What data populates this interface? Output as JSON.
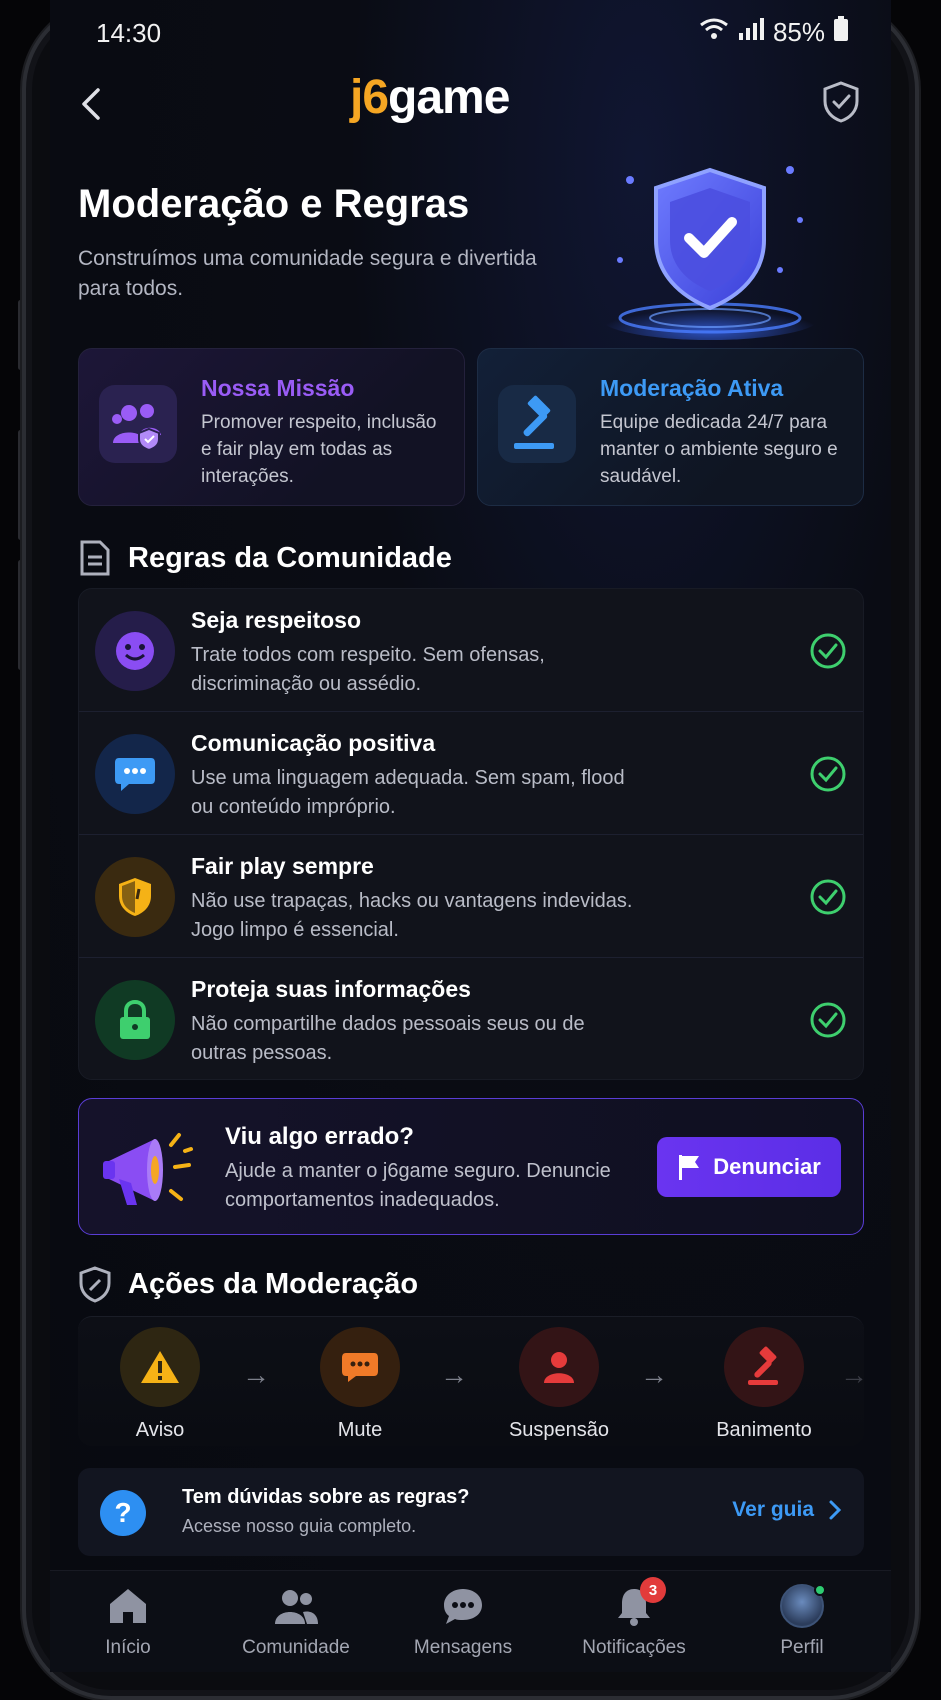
{
  "status_bar": {
    "time": "14:30",
    "battery": "85%"
  },
  "header": {
    "logo_part1": "j6",
    "logo_part2": "game"
  },
  "hero": {
    "title": "Moderação e Regras",
    "subtitle": "Construímos uma comunidade segura e divertida para todos."
  },
  "info_cards": [
    {
      "title": "Nossa Missão",
      "text": "Promover respeito, inclusão e fair play em todas as interações."
    },
    {
      "title": "Moderação Ativa",
      "text": "Equipe dedicada 24/7 para manter o ambiente seguro e saudável."
    }
  ],
  "rules_section": {
    "title": "Regras da Comunidade",
    "rules": [
      {
        "title": "Seja respeitoso",
        "text": "Trate todos com respeito. Sem ofensas, discriminação ou assédio.",
        "icon": "smile-icon"
      },
      {
        "title": "Comunicação positiva",
        "text": "Use uma linguagem adequada. Sem spam, flood ou conteúdo impróprio.",
        "icon": "chat-icon"
      },
      {
        "title": "Fair play sempre",
        "text": "Não use trapaças, hacks ou vantagens indevidas. Jogo limpo é essencial.",
        "icon": "shield-icon"
      },
      {
        "title": "Proteja suas informações",
        "text": "Não compartilhe dados pessoais seus ou de outras pessoas.",
        "icon": "lock-icon"
      }
    ]
  },
  "report": {
    "title": "Viu algo errado?",
    "text": "Ajude a manter o j6game seguro. Denuncie comportamentos inadequados.",
    "button": "Denunciar"
  },
  "actions_section": {
    "title": "Ações da Moderação",
    "steps": [
      {
        "label": "Aviso",
        "icon": "warning-icon",
        "color": "#f5b216"
      },
      {
        "label": "Mute",
        "icon": "muted-chat-icon",
        "color": "#f07a28"
      },
      {
        "label": "Suspensão",
        "icon": "user-icon",
        "color": "#e63b3b"
      },
      {
        "label": "Banimento",
        "icon": "gavel-icon",
        "color": "#e63b3b"
      }
    ]
  },
  "faq": {
    "title": "Tem dúvidas sobre as regras?",
    "subtitle": "Acesse nosso guia completo.",
    "link": "Ver guia"
  },
  "bottom_nav": {
    "items": [
      {
        "label": "Início",
        "icon": "home-icon"
      },
      {
        "label": "Comunidade",
        "icon": "community-icon"
      },
      {
        "label": "Mensagens",
        "icon": "messages-icon"
      },
      {
        "label": "Notificações",
        "icon": "bell-icon",
        "badge": "3"
      },
      {
        "label": "Perfil",
        "icon": "avatar"
      }
    ]
  },
  "colors": {
    "accent_purple": "#6a34f0",
    "accent_blue": "#3d9af5",
    "logo_orange": "#f5a623",
    "check_green": "#3ecf6e"
  }
}
